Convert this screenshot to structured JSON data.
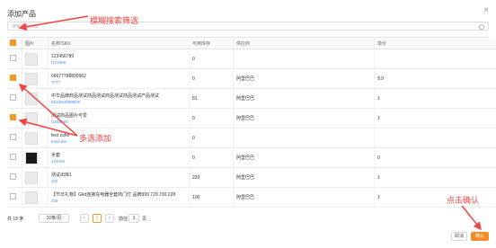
{
  "dialog": {
    "title": "添加产品",
    "close": "×",
    "search_placeholder": "搜索产品SKU"
  },
  "table": {
    "headers": [
      "图片",
      "名称/SKU",
      "可用库存",
      "供应商",
      "单价"
    ],
    "rows": [
      {
        "checked": false,
        "name": "123456789",
        "code": "f123456",
        "stock": "0",
        "supplier": "",
        "price": ""
      },
      {
        "checked": true,
        "name": "66677788899962",
        "code": "7777",
        "stock": "0",
        "supplier": "阿里巴巴",
        "price": "9.9"
      },
      {
        "checked": false,
        "name": "中华品牌商品测试商品测试商品测试商品测试产品测试",
        "code": "5816518889930",
        "stock": "81",
        "supplier": "阿里巴巴",
        "price": "1"
      },
      {
        "checked": true,
        "name": "测试商品图片可爱",
        "code": "f1656994",
        "stock": "0",
        "supplier": "阿里巴巴",
        "price": "1"
      },
      {
        "checked": false,
        "name": "test zuhe",
        "code": "testzuhe",
        "stock": "0",
        "supplier": "",
        "price": ""
      },
      {
        "checked": false,
        "name": "手套",
        "code": "123456",
        "stock": "0",
        "supplier": "阿里巴巴",
        "price": "0"
      },
      {
        "checked": false,
        "name": "测试出库1",
        "code": "222",
        "stock": "220",
        "supplier": "阿里巴巴",
        "price": "1"
      },
      {
        "checked": false,
        "name": "【节日礼物】Gkd连接充电器全套商门灯 品牌999 720 730 228",
        "code": "228",
        "stock": "100",
        "supplier": "阿里巴巴",
        "price": "1"
      }
    ]
  },
  "footer": {
    "total": "共 19 条",
    "page_size": "10条/页",
    "page": "1",
    "goto_label": "前往",
    "goto_value": "1",
    "page_unit": "页"
  },
  "buttons": {
    "cancel": "取消",
    "ok": "确认"
  },
  "annotations": {
    "fuzzy_search": "模糊搜索筛选",
    "multi_select": "多选添加",
    "click_confirm": "点击确认"
  },
  "colors": {
    "accent": "#f39a25",
    "annotation": "#f04444",
    "link": "#4a8ff7"
  }
}
